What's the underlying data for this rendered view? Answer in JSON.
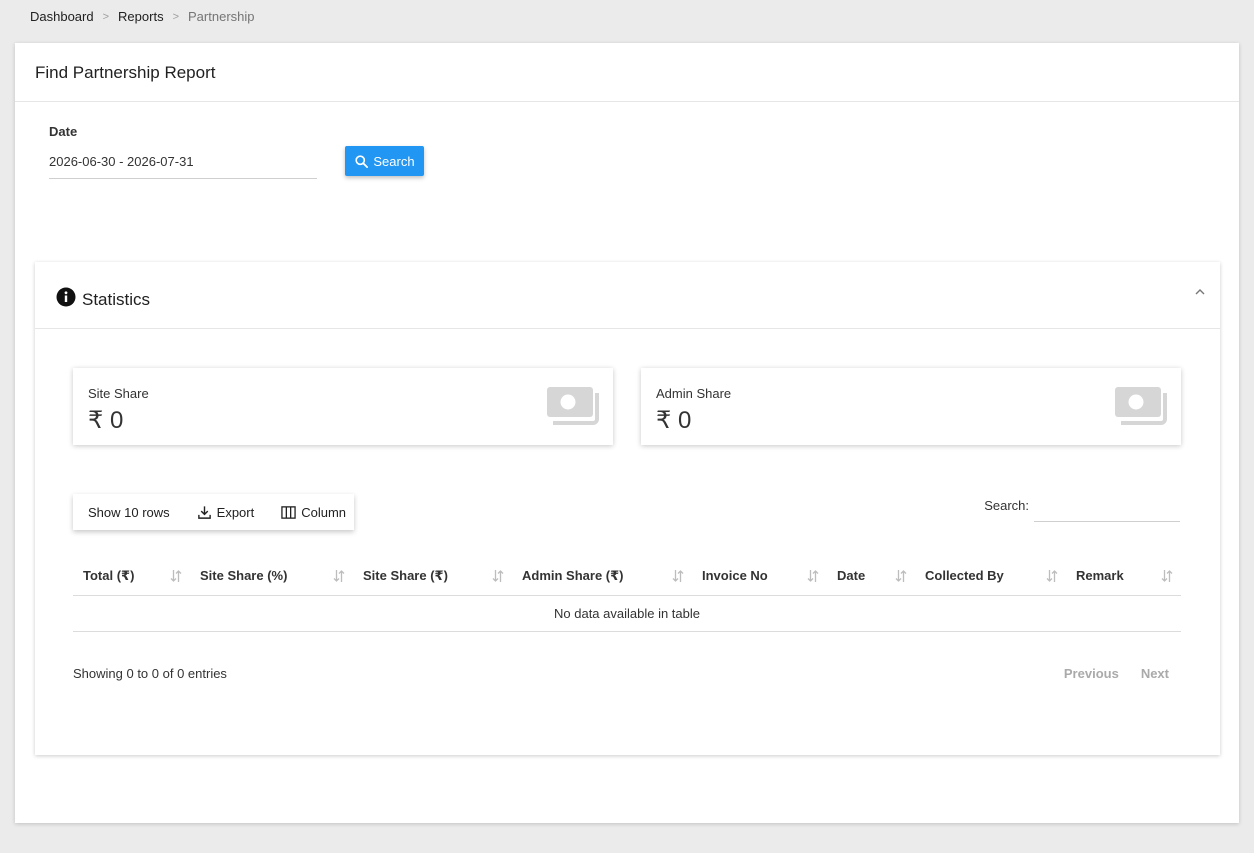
{
  "breadcrumb": {
    "items": [
      "Dashboard",
      "Reports"
    ],
    "separator": ">",
    "current": "Partnership"
  },
  "card": {
    "title": "Find Partnership Report"
  },
  "filters": {
    "date_label": "Date",
    "date_value": "2026-06-30 - 2026-07-31",
    "search_button": "Search"
  },
  "statistics": {
    "title": "Statistics",
    "site_share": {
      "label": "Site Share",
      "value": "₹ 0"
    },
    "admin_share": {
      "label": "Admin Share",
      "value": "₹ 0"
    }
  },
  "toolbar": {
    "show_rows": "Show 10 rows",
    "export": "Export",
    "column": "Column"
  },
  "table": {
    "search_label": "Search:",
    "search_value": "",
    "columns": [
      "Total (₹)",
      "Site Share (%)",
      "Site Share (₹)",
      "Admin Share (₹)",
      "Invoice No",
      "Date",
      "Collected By",
      "Remark"
    ],
    "empty_message": "No data available in table",
    "info": "Showing 0 to 0 of 0 entries",
    "previous": "Previous",
    "next": "Next"
  },
  "colors": {
    "accent": "#2196f3",
    "background": "#ebebeb"
  }
}
